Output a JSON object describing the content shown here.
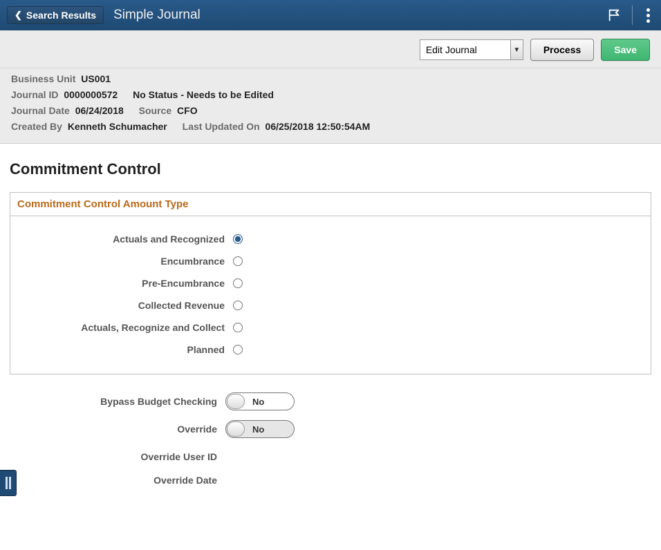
{
  "header": {
    "back_label": "Search Results",
    "title": "Simple Journal"
  },
  "actions": {
    "dropdown_options": [
      "Edit Journal"
    ],
    "dropdown_selected": "Edit Journal",
    "process_label": "Process",
    "save_label": "Save"
  },
  "meta": {
    "business_unit_label": "Business Unit",
    "business_unit": "US001",
    "journal_id_label": "Journal ID",
    "journal_id": "0000000572",
    "status": "No Status - Needs to be Edited",
    "journal_date_label": "Journal Date",
    "journal_date": "06/24/2018",
    "source_label": "Source",
    "source": "CFO",
    "created_by_label": "Created By",
    "created_by": "Kenneth Schumacher",
    "last_updated_label": "Last Updated On",
    "last_updated": "06/25/2018 12:50:54AM"
  },
  "main": {
    "section_title": "Commitment Control",
    "panel_title": "Commitment Control Amount Type",
    "amount_types": [
      {
        "label": "Actuals and Recognized",
        "selected": true
      },
      {
        "label": "Encumbrance",
        "selected": false
      },
      {
        "label": "Pre-Encumbrance",
        "selected": false
      },
      {
        "label": "Collected Revenue",
        "selected": false
      },
      {
        "label": "Actuals, Recognize and Collect",
        "selected": false
      },
      {
        "label": "Planned",
        "selected": false
      }
    ],
    "bypass_label": "Bypass Budget Checking",
    "bypass_value": "No",
    "override_label": "Override",
    "override_value": "No",
    "override_userid_label": "Override User ID",
    "override_userid": "",
    "override_date_label": "Override Date",
    "override_date": ""
  }
}
